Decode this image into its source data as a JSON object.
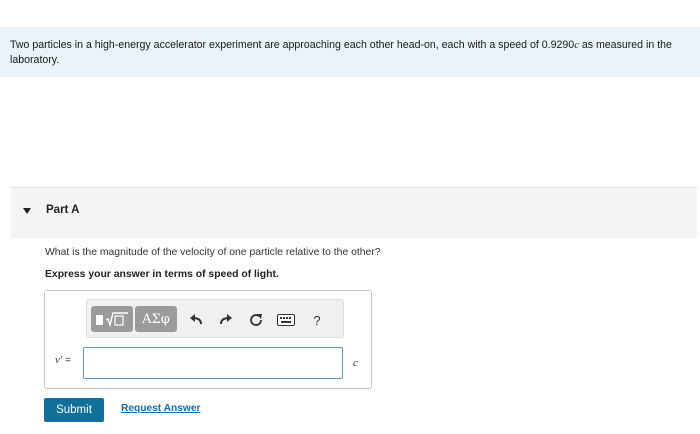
{
  "problem": {
    "text_before": "Two particles in a high-energy accelerator experiment are approaching each other head-on, each with a speed of 0.9290",
    "speed_unit": "c",
    "text_after": " as measured in the laboratory."
  },
  "part": {
    "title": "Part A",
    "question": "What is the magnitude of the velocity of one particle relative to the other?",
    "instruction": "Express your answer in terms of speed of light."
  },
  "toolbar": {
    "greek_label": "ΑΣφ",
    "help_label": "?"
  },
  "answer": {
    "variable": "v′",
    "equals": " =",
    "value": "",
    "unit": "c"
  },
  "actions": {
    "submit_label": "Submit",
    "request_label": "Request Answer"
  },
  "colors": {
    "intro_bg": "#e8f4f8",
    "submit_bg": "#10709a",
    "link": "#1d6aa5",
    "toolbar_button": "#9b9b9b"
  }
}
